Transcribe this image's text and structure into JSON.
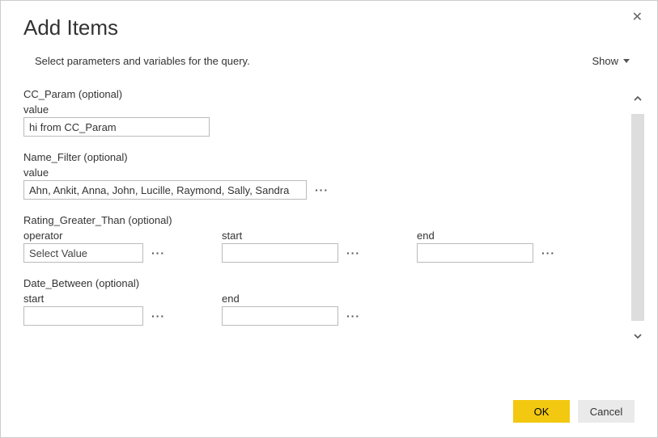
{
  "dialog": {
    "title": "Add Items",
    "instructions": "Select parameters and variables for the query.",
    "show_label": "Show"
  },
  "params": {
    "cc_param": {
      "title": "CC_Param (optional)",
      "value_label": "value",
      "value": "hi from CC_Param"
    },
    "name_filter": {
      "title": "Name_Filter (optional)",
      "value_label": "value",
      "value": "Ahn, Ankit, Anna, John, Lucille, Raymond, Sally, Sandra"
    },
    "rating_gt": {
      "title": "Rating_Greater_Than (optional)",
      "operator_label": "operator",
      "operator_placeholder": "Select Value",
      "start_label": "start",
      "start_value": "",
      "end_label": "end",
      "end_value": ""
    },
    "date_between": {
      "title": "Date_Between (optional)",
      "start_label": "start",
      "start_value": "",
      "end_label": "end",
      "end_value": ""
    }
  },
  "footer": {
    "ok": "OK",
    "cancel": "Cancel"
  },
  "icons": {
    "more": "···"
  }
}
